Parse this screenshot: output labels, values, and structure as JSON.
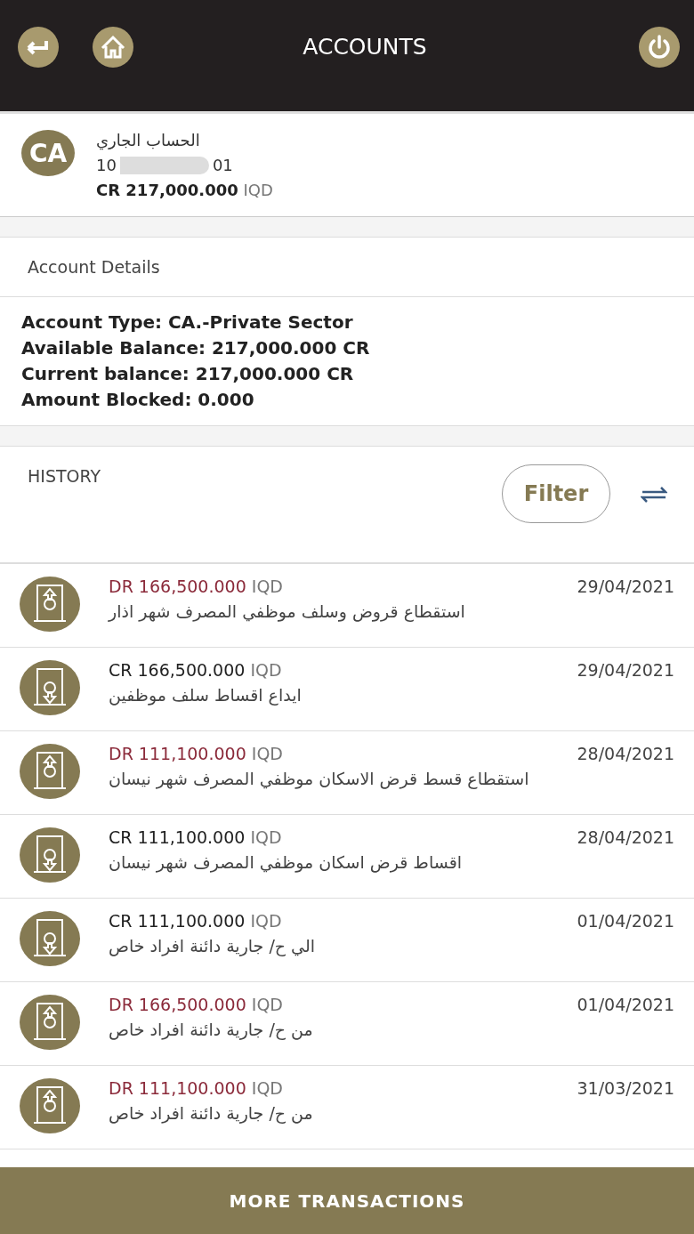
{
  "header": {
    "title": "ACCOUNTS"
  },
  "account": {
    "badge": "CA",
    "name": "الحساب الجاري",
    "number_start": "10",
    "number_end": "01",
    "amount": "CR 217,000.000",
    "currency": "IQD"
  },
  "details": {
    "title": "Account Details",
    "lines": [
      "Account Type: CA.-Private Sector",
      "Available Balance: 217,000.000 CR",
      "Current balance: 217,000.000 CR",
      "Amount Blocked: 0.000"
    ]
  },
  "history": {
    "title": "HISTORY",
    "filter": "Filter"
  },
  "transactions": [
    {
      "kind": "debit",
      "amount": "DR 166,500.000",
      "currency": "IQD",
      "date": "29/04/2021",
      "description": "استقطاع قروض وسلف موظفي المصرف شهر اذار"
    },
    {
      "kind": "credit",
      "amount": "CR 166,500.000",
      "currency": "IQD",
      "date": "29/04/2021",
      "description": "ايداع اقساط سلف موظفين"
    },
    {
      "kind": "debit",
      "amount": "DR 111,100.000",
      "currency": "IQD",
      "date": "28/04/2021",
      "description": "استقطاع قسط قرض الاسكان موظفي المصرف شهر نيسان"
    },
    {
      "kind": "credit",
      "amount": "CR 111,100.000",
      "currency": "IQD",
      "date": "28/04/2021",
      "description": "اقساط قرض اسكان موظفي المصرف شهر نيسان"
    },
    {
      "kind": "credit",
      "amount": "CR 111,100.000",
      "currency": "IQD",
      "date": "01/04/2021",
      "description": "الي ح/ جارية دائنة افراد خاص"
    },
    {
      "kind": "debit",
      "amount": "DR 166,500.000",
      "currency": "IQD",
      "date": "01/04/2021",
      "description": "من ح/ جارية دائنة افراد خاص"
    },
    {
      "kind": "debit",
      "amount": "DR 111,100.000",
      "currency": "IQD",
      "date": "31/03/2021",
      "description": "من ح/ جارية دائنة افراد خاص"
    }
  ],
  "footer_button": "MORE TRANSACTIONS"
}
